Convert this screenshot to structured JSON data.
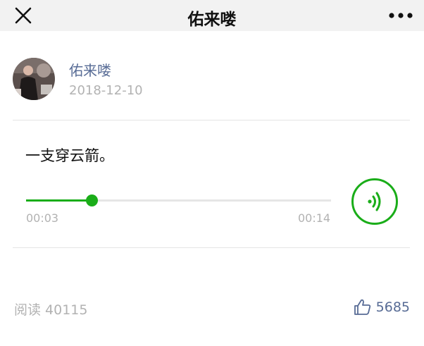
{
  "nav": {
    "title": "佑来喽",
    "close_icon": "close-icon",
    "more_icon": "more-icon"
  },
  "author": {
    "name": "佑来喽",
    "date": "2018-12-10",
    "avatar": "avatar-photo"
  },
  "post": {
    "text": "一支穿云箭。"
  },
  "audio": {
    "current_time": "00:03",
    "total_time": "00:14",
    "progress": 0.214,
    "play_icon": "audio-wave-icon"
  },
  "footer": {
    "reads": "阅读 40115",
    "likes": "5685",
    "like_icon": "thumbs-up-icon"
  },
  "colors": {
    "accent_green": "#1aad19",
    "link_blue": "#576b95",
    "muted_gray": "#b2b2b2",
    "nav_bg": "#f2f2f2"
  }
}
